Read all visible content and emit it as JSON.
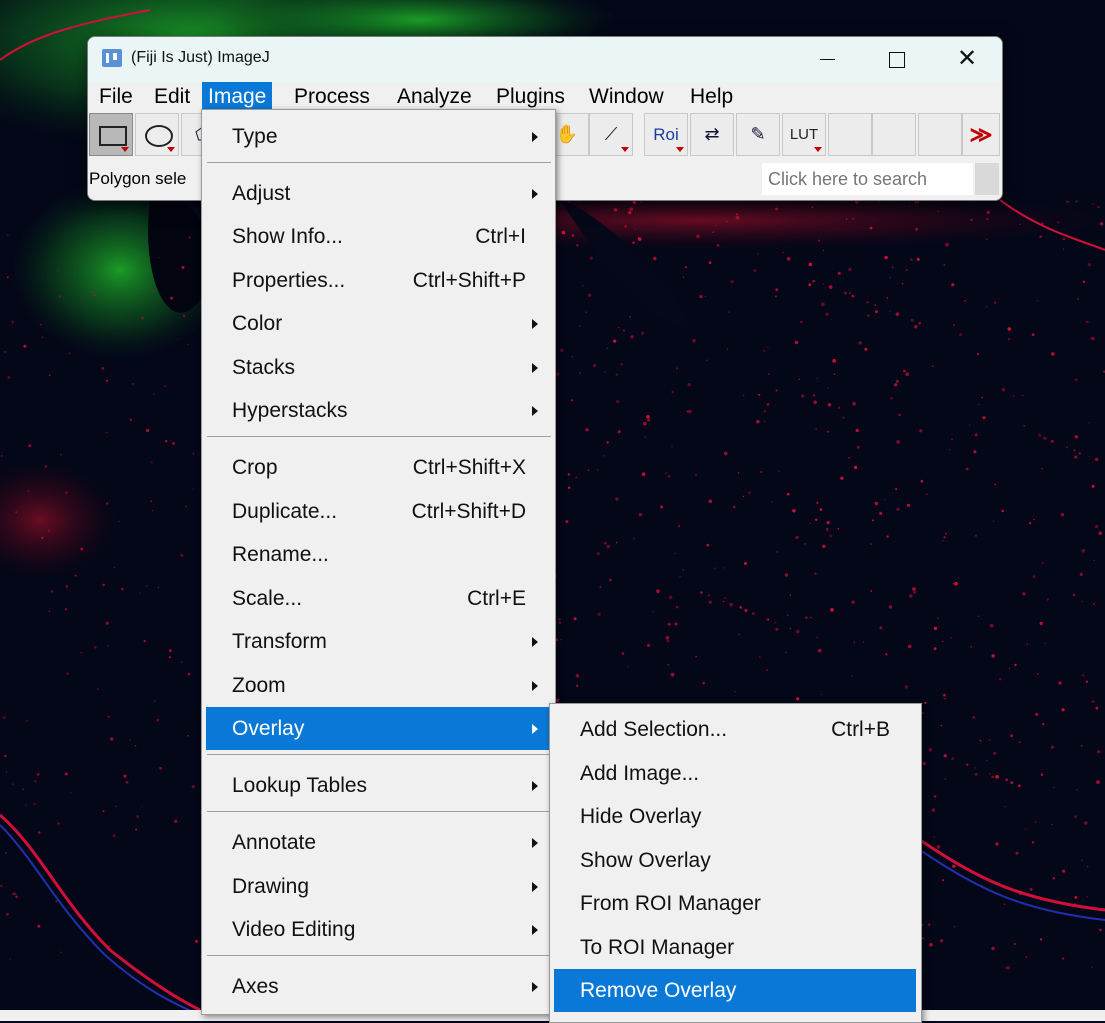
{
  "window": {
    "title": "(Fiji Is Just) ImageJ",
    "minimize": "─",
    "maximize": "□",
    "close": "✕"
  },
  "menubar": [
    "File",
    "Edit",
    "Image",
    "Process",
    "Analyze",
    "Plugins",
    "Window",
    "Help"
  ],
  "active_menu": "Image",
  "toolbar": {
    "tools": [
      {
        "icon": "rectangle-selection-icon"
      },
      {
        "icon": "oval-selection-icon"
      },
      {
        "icon": "polygon-selection-icon"
      },
      {
        "icon": "hand-icon"
      },
      {
        "icon": "dropper-icon"
      },
      {
        "icon": "roi-icon",
        "label": "Roi"
      },
      {
        "icon": "arrows-icon"
      },
      {
        "icon": "pencil-icon"
      },
      {
        "icon": "lut-icon",
        "label": "LUT"
      },
      {
        "icon": "empty-tool"
      },
      {
        "icon": "empty-tool"
      },
      {
        "icon": "empty-tool"
      },
      {
        "icon": "more-tools-icon",
        "label": "≫"
      }
    ]
  },
  "status": {
    "text": "Polygon sele",
    "search_placeholder": "Click here to search"
  },
  "image_menu": {
    "items": [
      {
        "label": "Type",
        "shortcut": "",
        "submenu": true
      },
      {
        "label": "Adjust",
        "shortcut": "",
        "submenu": true
      },
      {
        "label": "Show Info...",
        "shortcut": "Ctrl+I",
        "submenu": false
      },
      {
        "label": "Properties...",
        "shortcut": "Ctrl+Shift+P",
        "submenu": false
      },
      {
        "label": "Color",
        "shortcut": "",
        "submenu": true
      },
      {
        "label": "Stacks",
        "shortcut": "",
        "submenu": true
      },
      {
        "label": "Hyperstacks",
        "shortcut": "",
        "submenu": true
      },
      {
        "label": "Crop",
        "shortcut": "Ctrl+Shift+X",
        "submenu": false
      },
      {
        "label": "Duplicate...",
        "shortcut": "Ctrl+Shift+D",
        "submenu": false
      },
      {
        "label": "Rename...",
        "shortcut": "",
        "submenu": false
      },
      {
        "label": "Scale...",
        "shortcut": "Ctrl+E",
        "submenu": false
      },
      {
        "label": "Transform",
        "shortcut": "",
        "submenu": true
      },
      {
        "label": "Zoom",
        "shortcut": "",
        "submenu": true
      },
      {
        "label": "Overlay",
        "shortcut": "",
        "submenu": true,
        "highlighted": true
      },
      {
        "label": "Lookup Tables",
        "shortcut": "",
        "submenu": true
      },
      {
        "label": "Annotate",
        "shortcut": "",
        "submenu": true
      },
      {
        "label": "Drawing",
        "shortcut": "",
        "submenu": true
      },
      {
        "label": "Video Editing",
        "shortcut": "",
        "submenu": true
      },
      {
        "label": "Axes",
        "shortcut": "",
        "submenu": true
      }
    ]
  },
  "overlay_menu": {
    "items": [
      {
        "label": "Add Selection...",
        "shortcut": "Ctrl+B"
      },
      {
        "label": "Add Image...",
        "shortcut": ""
      },
      {
        "label": "Hide Overlay",
        "shortcut": ""
      },
      {
        "label": "Show Overlay",
        "shortcut": ""
      },
      {
        "label": "From ROI Manager",
        "shortcut": ""
      },
      {
        "label": "To ROI Manager",
        "shortcut": ""
      },
      {
        "label": "Remove Overlay",
        "shortcut": "",
        "highlighted": true
      }
    ]
  },
  "colors": {
    "menu_highlight": "#0a78d7",
    "title_bar": "#e9f6f5",
    "background_image_base": "#030718",
    "red_channel": "#e0103a",
    "green_channel": "#1fb52a",
    "blue_channel": "#2030b0"
  }
}
